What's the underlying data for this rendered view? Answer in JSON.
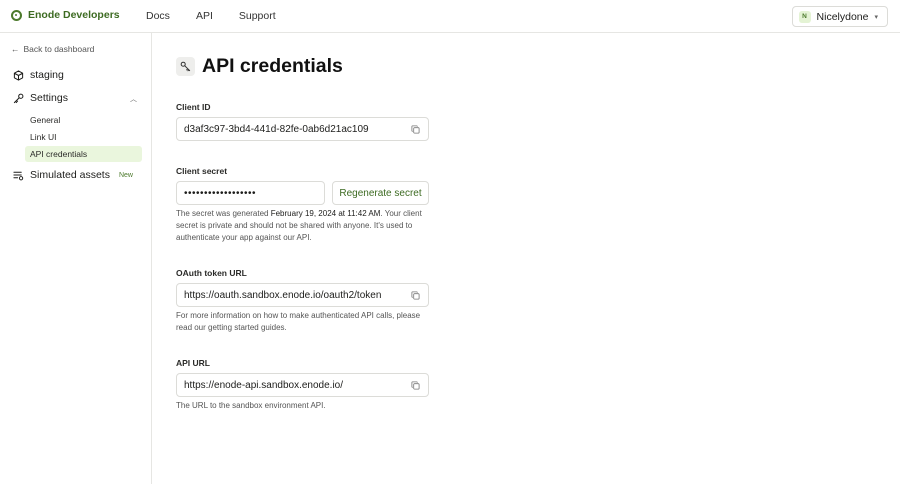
{
  "header": {
    "brand": "Enode Developers",
    "nav": [
      "Docs",
      "API",
      "Support"
    ],
    "user": {
      "initial": "N",
      "name": "Nicelydone"
    }
  },
  "sidebar": {
    "back_label": "Back to dashboard",
    "environment": "staging",
    "settings_label": "Settings",
    "settings_items": [
      "General",
      "Link UI",
      "API credentials"
    ],
    "active_item": "API credentials",
    "simulated_label": "Simulated assets",
    "simulated_badge": "New"
  },
  "page": {
    "title": "API credentials",
    "client_id": {
      "label": "Client ID",
      "value": "d3af3c97-3bd4-441d-82fe-0ab6d21ac109"
    },
    "client_secret": {
      "label": "Client secret",
      "masked_value": "••••••••••••••••••",
      "regenerate_label": "Regenerate secret",
      "help_prefix": "The secret was generated ",
      "help_date": "February 19, 2024 at 11:42 AM",
      "help_suffix": ". Your client secret is private and should not be shared with anyone. It's used to authenticate your app against our API."
    },
    "oauth_url": {
      "label": "OAuth token URL",
      "value": "https://oauth.sandbox.enode.io/oauth2/token",
      "help": "For more information on how to make authenticated API calls, please read our getting started guides."
    },
    "api_url": {
      "label": "API URL",
      "value": "https://enode-api.sandbox.enode.io/",
      "help": "The URL to the sandbox environment API."
    }
  },
  "colors": {
    "brand_green": "#3d6b22",
    "active_bg": "#eaf6dd",
    "border": "#dcdcd8"
  }
}
